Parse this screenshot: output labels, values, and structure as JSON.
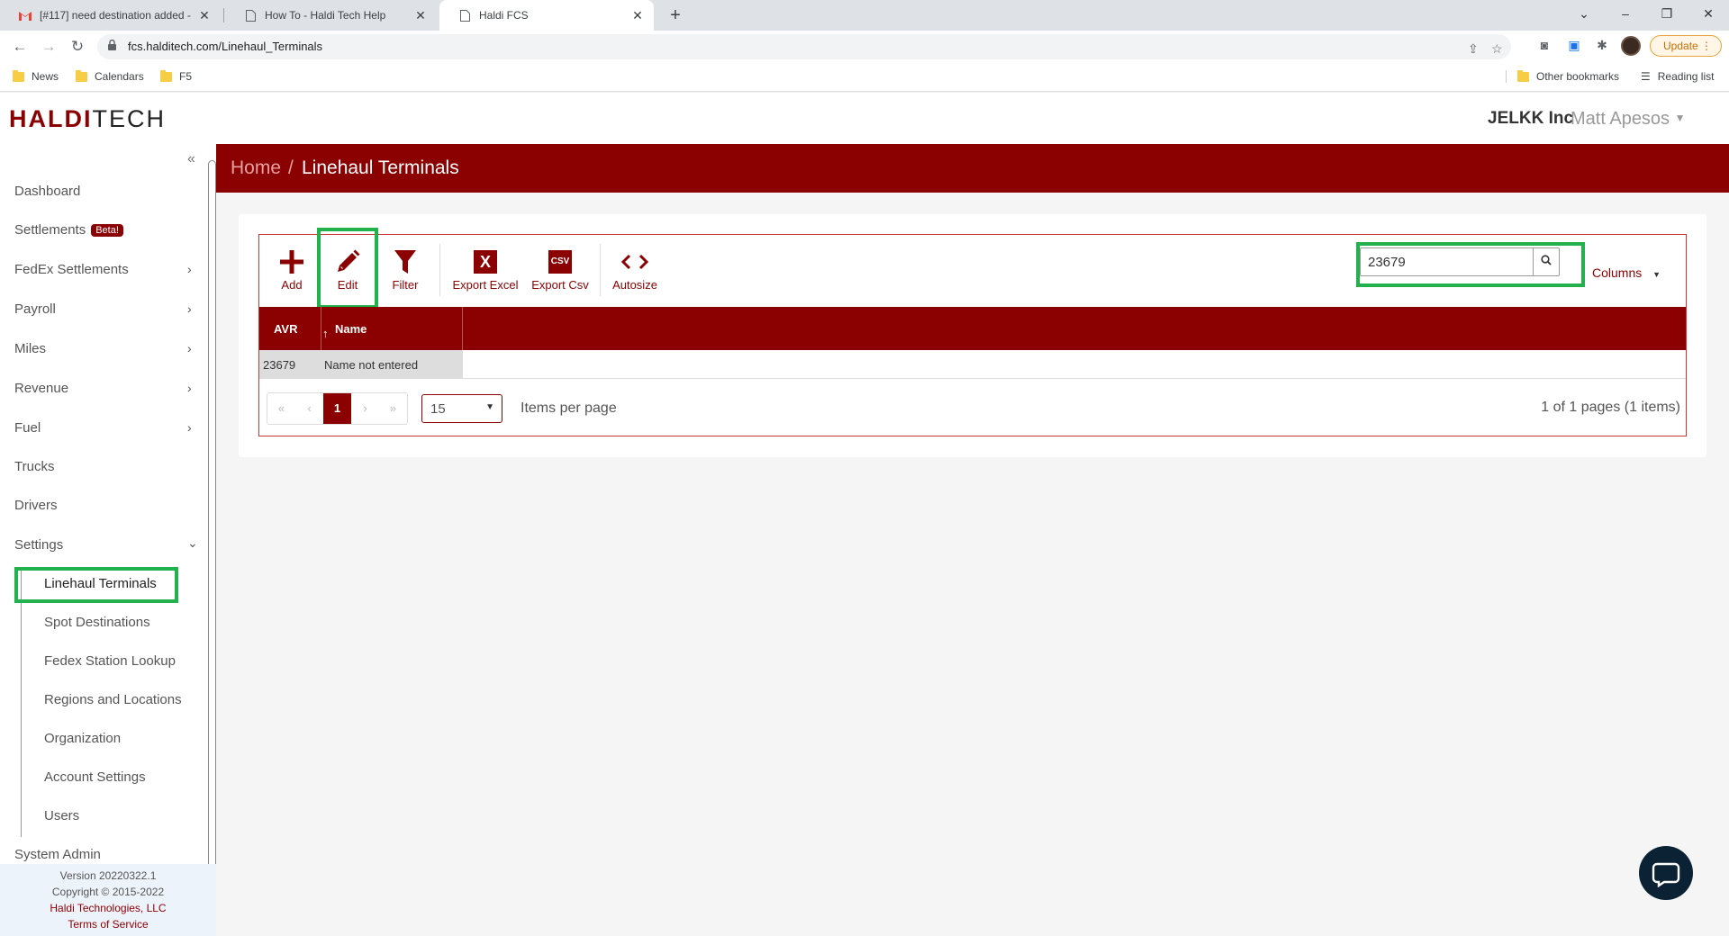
{
  "browser": {
    "tabs": [
      {
        "title": "[#117] need destination added -",
        "icon": "gmail-icon"
      },
      {
        "title": "How To - Haldi Tech Help",
        "icon": "page-icon"
      },
      {
        "title": "Haldi FCS",
        "icon": "page-icon"
      }
    ],
    "url": "fcs.halditech.com/Linehaul_Terminals",
    "update_label": "Update",
    "bookmarks": [
      "News",
      "Calendars",
      "F5"
    ],
    "other_bookmarks": "Other bookmarks",
    "reading_list": "Reading list"
  },
  "header": {
    "logo_part1": "HALDI",
    "logo_part2": "TECH",
    "org": "JELKK Inc",
    "user": "Matt Apesos"
  },
  "sidebar": {
    "items": [
      {
        "label": "Dashboard"
      },
      {
        "label": "Settlements",
        "badge": "Beta!"
      },
      {
        "label": "FedEx Settlements"
      },
      {
        "label": "Payroll"
      },
      {
        "label": "Miles"
      },
      {
        "label": "Revenue"
      },
      {
        "label": "Fuel"
      },
      {
        "label": "Trucks"
      },
      {
        "label": "Drivers"
      },
      {
        "label": "Settings"
      }
    ],
    "sub_items": [
      "Linehaul Terminals",
      "Spot Destinations",
      "Fedex Station Lookup",
      "Regions and Locations",
      "Organization",
      "Account Settings",
      "Users"
    ],
    "system_admin": "System Admin",
    "footer": {
      "version": "Version 20220322.1",
      "copyright": "Copyright © 2015-2022",
      "company": "Haldi Technologies, LLC",
      "terms": "Terms of Service"
    }
  },
  "breadcrumb": {
    "home": "Home",
    "separator": "/",
    "current": "Linehaul Terminals"
  },
  "toolbar": {
    "add": "Add",
    "edit": "Edit",
    "filter": "Filter",
    "export_excel": "Export Excel",
    "export_csv": "Export Csv",
    "autosize": "Autosize",
    "csv_icon_text": "CSV",
    "excel_icon_text": "X",
    "search_value": "23679",
    "columns": "Columns"
  },
  "grid": {
    "columns": [
      "AVR",
      "Name"
    ],
    "rows": [
      {
        "avr": "23679",
        "name": "Name not entered"
      }
    ]
  },
  "pager": {
    "current_page": "1",
    "per_page": "15",
    "items_per_page_label": "Items per page",
    "page_info": "1 of 1 pages (1 items)"
  },
  "colors": {
    "brand": "#8b0000",
    "highlight": "#22b14c"
  }
}
